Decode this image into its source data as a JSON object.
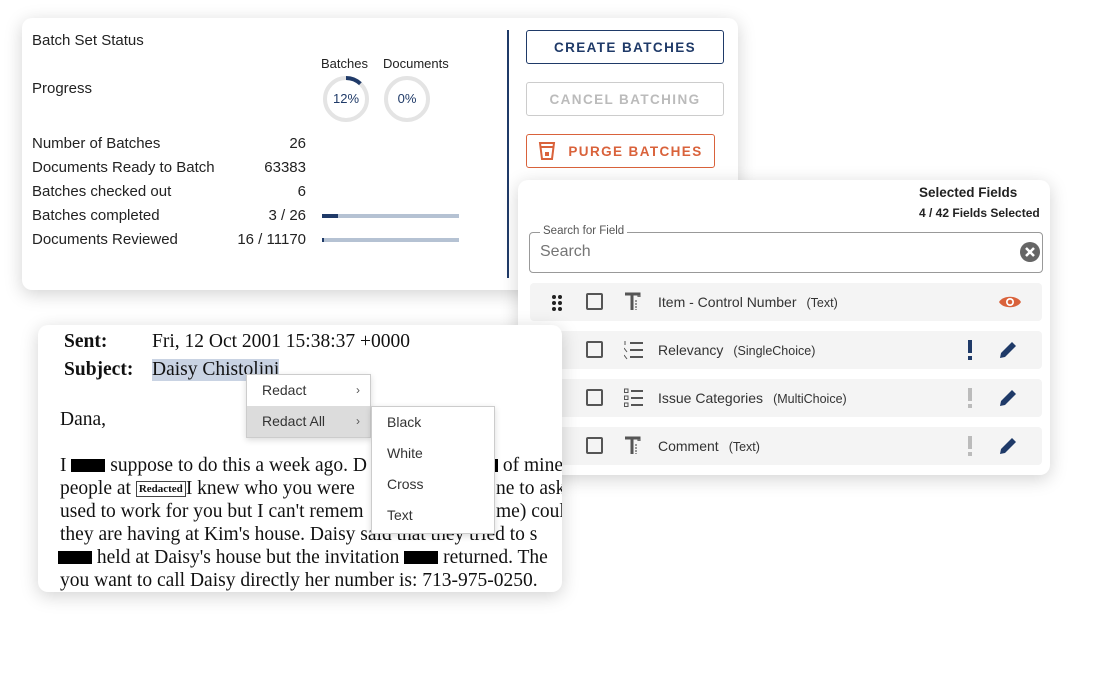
{
  "batch_status": {
    "title": "Batch Set Status",
    "progress_label": "Progress",
    "rings": [
      {
        "label": "Batches",
        "value_text": "12%",
        "percent": 12
      },
      {
        "label": "Documents",
        "value_text": "0%",
        "percent": 0
      }
    ],
    "stats": [
      {
        "label": "Number of Batches",
        "value": "26"
      },
      {
        "label": "Documents Ready to Batch",
        "value": "63383"
      },
      {
        "label": "Batches checked out",
        "value": "6"
      },
      {
        "label": "Batches completed",
        "value": "3 / 26",
        "bar_percent": 11.5
      },
      {
        "label": "Documents Reviewed",
        "value": "16 / 11170",
        "bar_percent": 0.14
      }
    ],
    "buttons": {
      "create": "CREATE BATCHES",
      "cancel": "CANCEL BATCHING",
      "purge": "PURGE BATCHES"
    },
    "colors": {
      "primary": "#1f3a68",
      "danger": "#d9623b",
      "disabled": "#bbbbbb"
    }
  },
  "fields": {
    "title": "Selected Fields",
    "count": "4 / 42 Fields Selected",
    "search_label": "Search for Field",
    "search_placeholder": "Search",
    "rows": [
      {
        "name": "Item - Control Number",
        "type": "(Text)",
        "icon": "text-field-icon",
        "action": "eye-icon"
      },
      {
        "name": "Relevancy",
        "type": "(SingleChoice)",
        "icon": "numbered-list-icon",
        "required": true
      },
      {
        "name": "Issue Categories",
        "type": "(MultiChoice)",
        "icon": "checklist-icon",
        "required": false
      },
      {
        "name": "Comment",
        "type": "(Text)",
        "icon": "text-field-icon",
        "required": false
      }
    ]
  },
  "document": {
    "sent_label": "Sent",
    "sent_value": "Fri, 12 Oct 2001 15:38:37 +0000",
    "subject_label": "Subject",
    "subject_value": "Daisy Chistolini",
    "greeting": "Dana,",
    "redacted_tag": "Redacted",
    "lines": [
      {
        "a": "I",
        "b": "suppose to do this a week ago. D",
        "r": "of mine"
      },
      {
        "a": "people at",
        "b": "I knew who you were",
        "r": "ne to ask"
      },
      {
        "a": "used to work for you but I can't remem",
        "r": "me) coul"
      },
      {
        "a": "they are having at Kim's house. Daisy said that they tried to s"
      },
      {
        "a": "held at Daisy's house but the invitation",
        "b": "returned. The"
      },
      {
        "a": "you want to call Daisy directly her number is: 713-975-0250."
      }
    ]
  },
  "context_menu": {
    "items": [
      "Redact",
      "Redact All"
    ],
    "submenu": [
      "Black",
      "White",
      "Cross",
      "Text"
    ]
  }
}
